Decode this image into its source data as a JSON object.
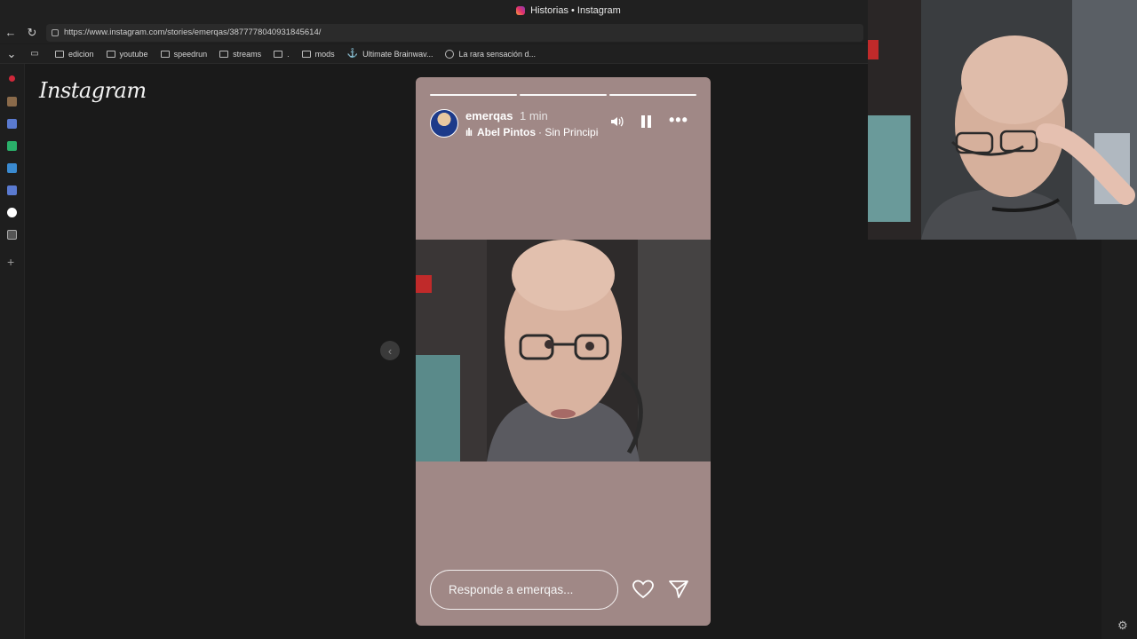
{
  "window": {
    "title": "Historias • Instagram"
  },
  "address_bar": {
    "url": "https://www.instagram.com/stories/emerqas/3877778040931845614/"
  },
  "bookmarks": [
    {
      "label": "edicion",
      "icon": "folder-icon"
    },
    {
      "label": "youtube",
      "icon": "folder-icon"
    },
    {
      "label": "speedrun",
      "icon": "folder-icon"
    },
    {
      "label": "streams",
      "icon": "folder-icon"
    },
    {
      "label": ".",
      "icon": "folder-icon"
    },
    {
      "label": "mods",
      "icon": "folder-icon"
    },
    {
      "label": "Ultimate Brainwav...",
      "icon": "anchor-icon"
    },
    {
      "label": "La rara sensación d...",
      "icon": "globe-icon"
    }
  ],
  "sidebar": {
    "colors": [
      "#d0283a",
      "#8a6a4a",
      "#5a7ad0",
      "#2ab06a",
      "#3a8ad0",
      "#5a7ad0",
      "#ffffff",
      "#aaaaaa"
    ]
  },
  "app": {
    "logo": "Instagram"
  },
  "story": {
    "username": "emerqas",
    "time": "1 min",
    "music": {
      "artist": "Abel Pintos",
      "song": "· Sin Principio"
    },
    "progress_segments": 3,
    "reply_placeholder": "Responde a emerqas...",
    "background_color": "#a08886"
  }
}
